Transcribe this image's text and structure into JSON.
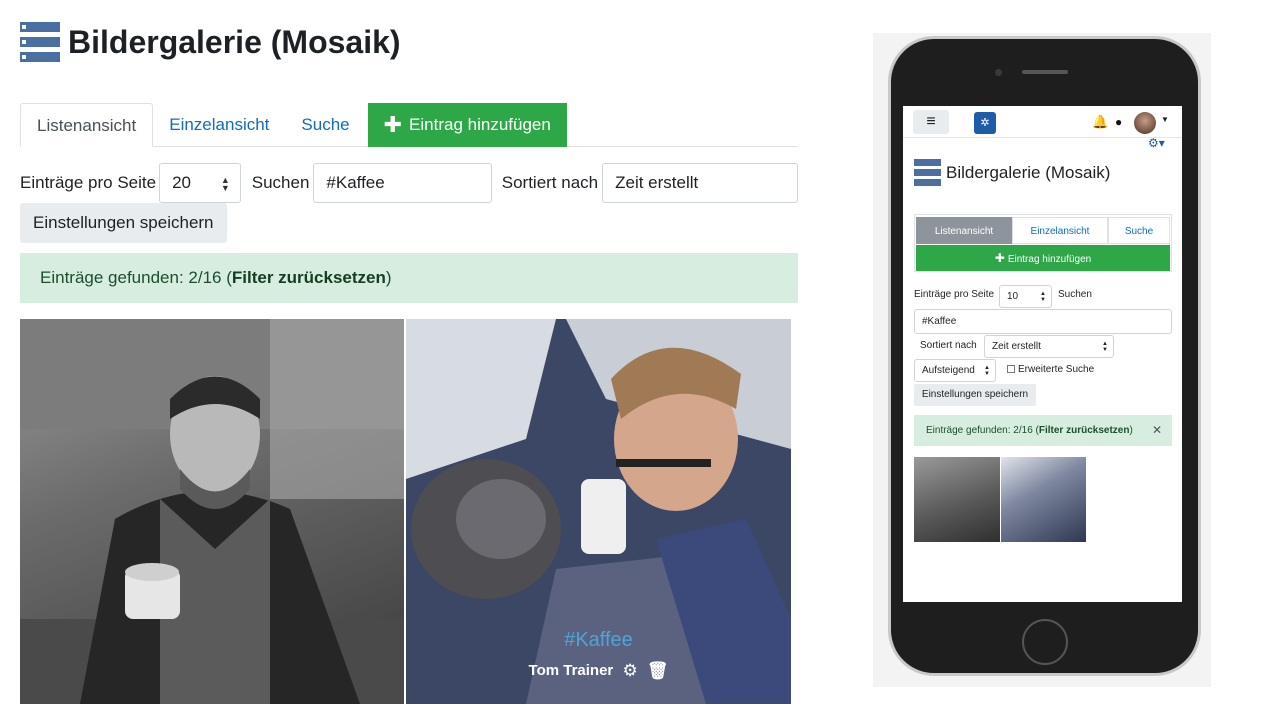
{
  "page": {
    "title": "Bildergalerie (Mosaik)",
    "tabs": [
      {
        "label": "Listenansicht",
        "active": true
      },
      {
        "label": "Einzelansicht",
        "active": false
      },
      {
        "label": "Suche",
        "active": false
      }
    ],
    "add_entry_label": "Eintrag hinzufügen",
    "filters": {
      "per_page_label": "Einträge pro Seite",
      "per_page_value": "20",
      "search_label": "Suchen",
      "search_value": "#Kaffee",
      "sort_label": "Sortiert nach",
      "sort_value": "Zeit erstellt"
    },
    "save_settings_label": "Einstellungen speichern",
    "alert": {
      "prefix": "Einträge gefunden: 2/16 (",
      "link": "Filter zurücksetzen",
      "suffix": ")"
    },
    "entries": [
      {
        "tag": "",
        "author": ""
      },
      {
        "tag": "#Kaffee",
        "author": "Tom Trainer"
      }
    ]
  },
  "mobile": {
    "title": "Bildergalerie (Mosaik)",
    "tabs": [
      "Listenansicht",
      "Einzelansicht",
      "Suche"
    ],
    "add_entry_label": "Eintrag hinzufügen",
    "per_page_label": "Einträge pro Seite",
    "per_page_value": "10",
    "search_label": "Suchen",
    "search_value": "#Kaffee",
    "sort_label": "Sortiert nach",
    "sort_value": "Zeit erstellt",
    "order_value": "Aufsteigend",
    "advanced_search_label": "Erweiterte Suche",
    "save_settings_label": "Einstellungen speichern",
    "alert_prefix": "Einträge gefunden: 2/16 (",
    "alert_link": "Filter zurücksetzen",
    "alert_suffix": ")",
    "notification_count": "1"
  },
  "icons": {
    "database": "database-icon",
    "plus": "plus-icon",
    "gear": "gear-icon",
    "trash": "trash-icon"
  },
  "colors": {
    "primary_link": "#0f6cbf",
    "success": "#2ea748",
    "alert_bg": "#d7ede0",
    "tag": "#4fa3d8",
    "db_icon": "#4c6fa3"
  }
}
